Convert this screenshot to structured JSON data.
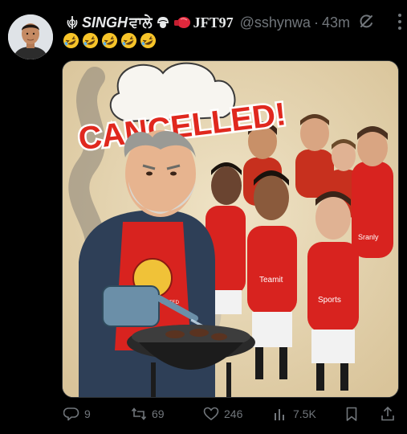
{
  "author": {
    "name": "SINGH",
    "name_suffix": "ਵਾਲੇ",
    "team_tag": "JFT97",
    "handle": "@sshynwa",
    "separator": "·",
    "time": "43m"
  },
  "post": {
    "emoji": [
      "rolling-laughing",
      "rolling-laughing",
      "rolling-laughing",
      "rolling-laughing",
      "rolling-laughing"
    ],
    "image": {
      "banner_text": "CANCELLED!",
      "apron_crest_text": "MANCHESTER UNITED",
      "shirt_sponsor_1": "Teamit",
      "shirt_sponsor_2": "Sports",
      "shirt_sponsor_3": "Sranly"
    }
  },
  "actions": {
    "replies": "9",
    "reposts": "69",
    "likes": "246",
    "views": "7.5K"
  },
  "colors": {
    "background": "#000000",
    "text_primary": "#e7e9ea",
    "text_secondary": "#71767b",
    "banner_red": "#e0281e",
    "kit_red": "#d8231f"
  },
  "icons": {
    "grok": "grok-icon",
    "more": "more-vertical-icon",
    "reply": "reply-icon",
    "repost": "repost-icon",
    "like": "heart-icon",
    "views": "views-icon",
    "bookmark": "bookmark-icon",
    "share": "share-icon"
  }
}
